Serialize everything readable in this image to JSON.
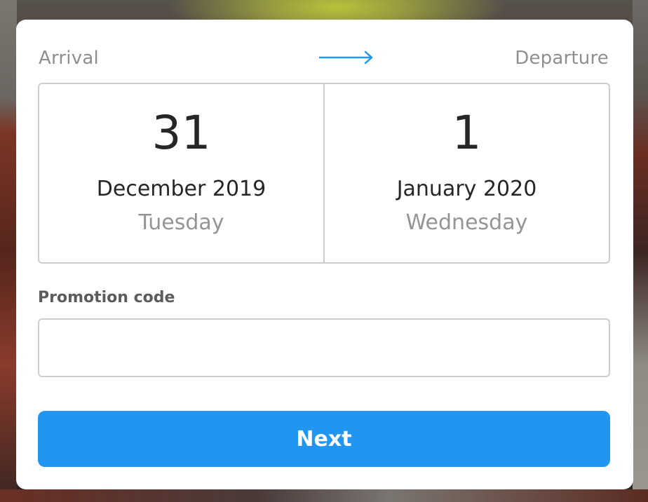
{
  "header": {
    "arrival_label": "Arrival",
    "departure_label": "Departure",
    "arrow_icon": "arrow-right-icon",
    "accent_color": "#2196f0"
  },
  "arrival": {
    "day": "31",
    "month_year": "December 2019",
    "weekday": "Tuesday"
  },
  "departure": {
    "day": "1",
    "month_year": "January 2020",
    "weekday": "Wednesday"
  },
  "promo": {
    "label": "Promotion code",
    "value": "",
    "placeholder": ""
  },
  "actions": {
    "next_label": "Next",
    "next_color": "#2196f0"
  }
}
